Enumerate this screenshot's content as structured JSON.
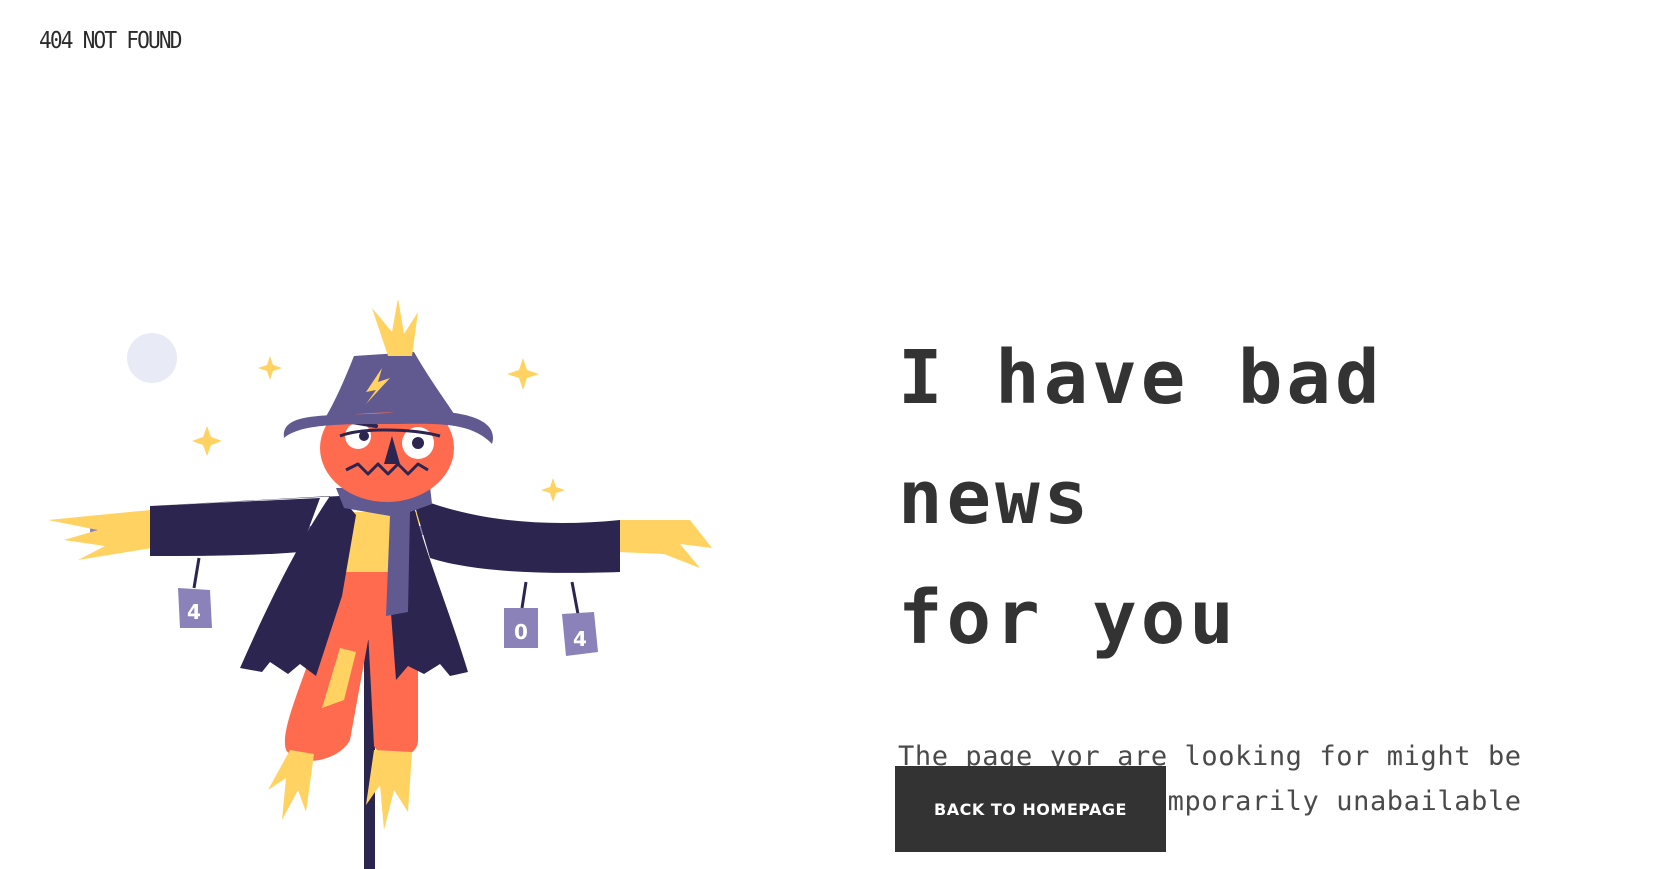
{
  "header": {
    "logo_text": "404 NOT FOUND"
  },
  "main": {
    "headline_line1": "I have bad news",
    "headline_line2": "for you",
    "description_line1": "The page yor are looking for might be",
    "description_line2": "removed or is temporarily unabailable",
    "button_label": "BACK TO HOMEPAGE"
  },
  "illustration": {
    "subject": "scarecrow",
    "can_labels": [
      "4",
      "0",
      "4"
    ]
  },
  "colors": {
    "text_dark": "#333333",
    "button_bg": "#333333",
    "button_text": "#ffffff",
    "hat_purple": "#605a91",
    "coat_navy": "#2b2550",
    "face_orange": "#ff6b4f",
    "straw_yellow": "#ffd262",
    "can_lavender": "#8a82b8",
    "moon": "#e8ebf5"
  }
}
